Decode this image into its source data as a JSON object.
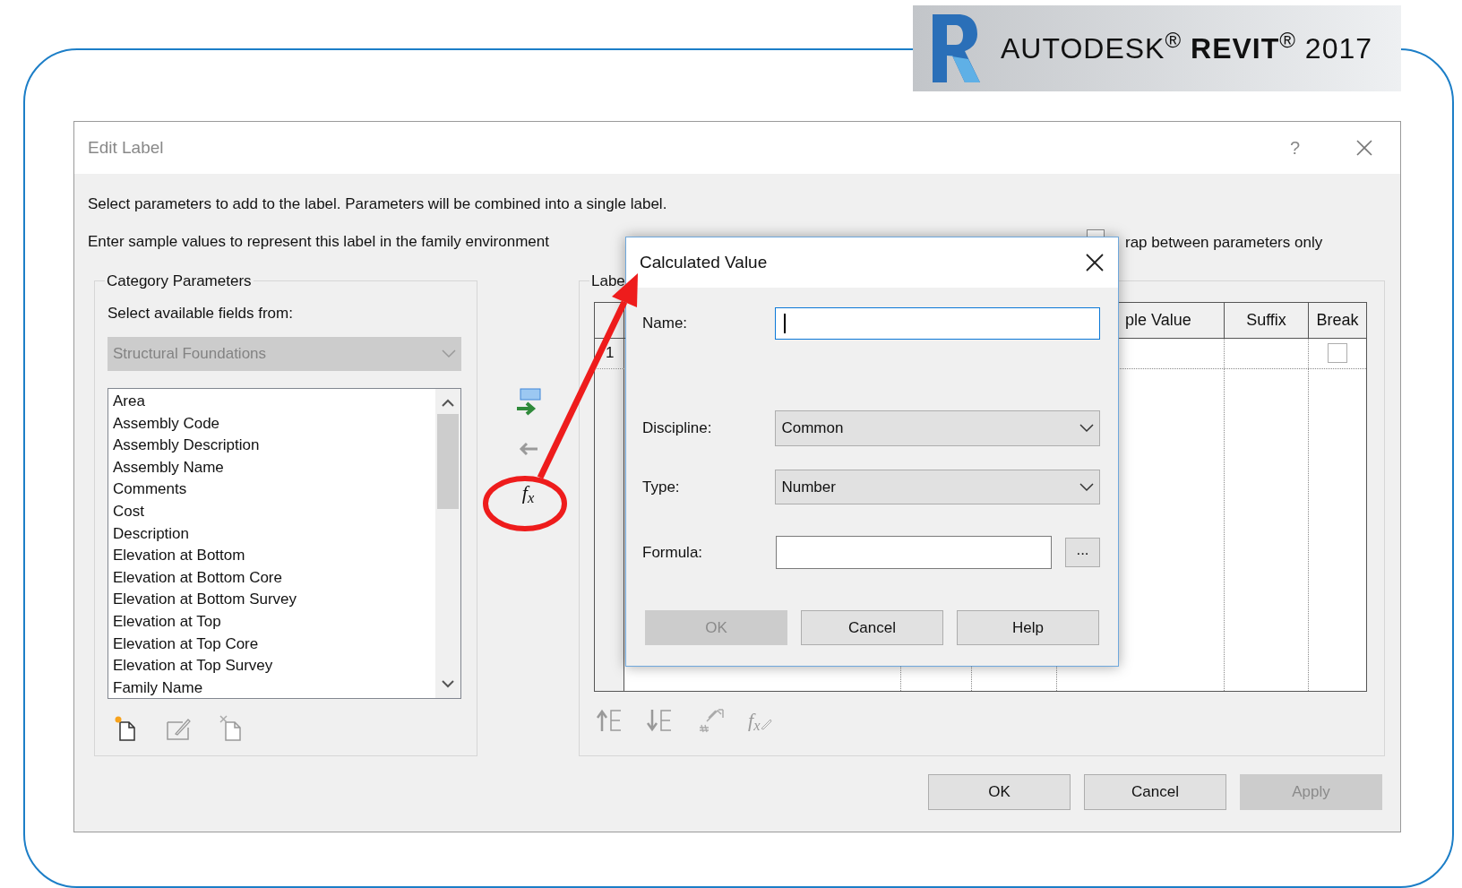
{
  "banner": {
    "text": "AUTODESK$^{®}$ **REVIT**$^{®}$ 2017"
  },
  "window": {
    "title": "Edit Label",
    "help": "?"
  },
  "instructions": [
    "Select parameters to add to the label.  Parameters will be combined into a single label.",
    "Enter sample values to represent this label in the family environment"
  ],
  "wrap_option": {
    "label": "rap between parameters only",
    "checked": false
  },
  "category_parameters": {
    "title": "Category Parameters",
    "source_label": "Select available fields from:",
    "source": {
      "value": "Structural Foundations",
      "disabled": true
    },
    "fields": [
      "Area",
      "Assembly Code",
      "Assembly Description",
      "Assembly Name",
      "Comments",
      "Cost",
      "Description",
      "Elevation at Bottom",
      "Elevation at Bottom Core",
      "Elevation at Bottom Survey",
      "Elevation at Top",
      "Elevation at Top Core",
      "Elevation at Top Survey",
      "Family Name"
    ]
  },
  "formula_button": "f$_{x}$",
  "label_parameters": {
    "title": "Labe",
    "columns": [
      "ple Value",
      "Suffix",
      "Break"
    ],
    "rows": [
      {
        "number": "1",
        "break": false
      }
    ],
    "tool_label": "f$_{x}$"
  },
  "buttons": [
    {
      "label": "OK",
      "disabled": false
    },
    {
      "label": "Cancel",
      "disabled": false
    },
    {
      "label": "Apply",
      "disabled": true
    }
  ],
  "calculated_value": {
    "title": "Calculated Value",
    "name": {
      "label": "Name:"
    },
    "discipline": {
      "label": "Discipline:",
      "value": "Common"
    },
    "type": {
      "label": "Type:",
      "value": "Number"
    },
    "formula": {
      "label": "Formula:",
      "browse": "..."
    },
    "buttons": [
      {
        "label": "OK",
        "disabled": true
      },
      {
        "label": "Cancel",
        "disabled": false
      },
      {
        "label": "Help",
        "disabled": false
      }
    ]
  }
}
